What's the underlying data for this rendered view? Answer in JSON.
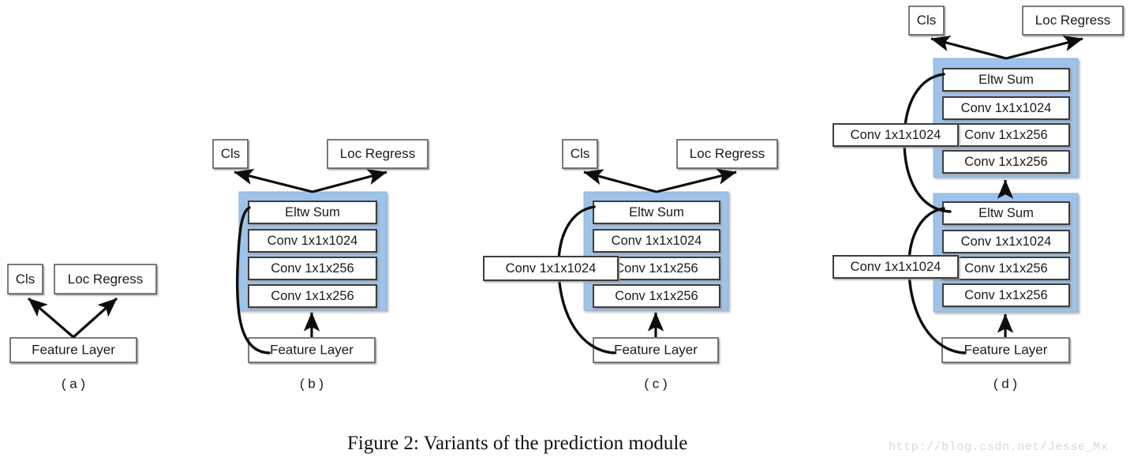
{
  "figure": {
    "caption": "Figure 2: Variants of the prediction module",
    "watermark": "http://blog.csdn.net/Jesse_Mx",
    "colors": {
      "group_fill": "#9ec2e8",
      "group_stroke": "#8db4dd",
      "box_fill": "#ffffff",
      "box_stroke": "#5a5a5a",
      "arrow": "#0d0d0d",
      "text": "#1a1a1a",
      "caption": "#111111",
      "watermark": "#d8d8d8",
      "background": "#ffffff"
    },
    "labels": {
      "cls": "Cls",
      "loc_regress": "Loc Regress",
      "feature_layer": "Feature Layer",
      "eltw_sum": "Eltw Sum",
      "conv_1024": "Conv 1x1x1024",
      "conv_256": "Conv 1x1x256"
    },
    "panels": [
      {
        "id": "a",
        "label": "( a )",
        "nodes": {
          "cls": "Cls",
          "loc_regress": "Loc Regress",
          "feature_layer": "Feature Layer"
        },
        "residual_blocks": 0,
        "has_skip_conv": false
      },
      {
        "id": "b",
        "label": "( b )",
        "nodes": {
          "cls": "Cls",
          "loc_regress": "Loc Regress",
          "feature_layer": "Feature Layer"
        },
        "residual_blocks": 1,
        "has_skip_conv": false,
        "block_layers": [
          "Eltw Sum",
          "Conv 1x1x1024",
          "Conv 1x1x256",
          "Conv 1x1x256"
        ]
      },
      {
        "id": "c",
        "label": "( c )",
        "nodes": {
          "cls": "Cls",
          "loc_regress": "Loc Regress",
          "feature_layer": "Feature Layer"
        },
        "residual_blocks": 1,
        "has_skip_conv": true,
        "skip_conv": "Conv 1x1x1024",
        "block_layers": [
          "Eltw Sum",
          "Conv 1x1x1024",
          "Conv 1x1x256",
          "Conv 1x1x256"
        ]
      },
      {
        "id": "d",
        "label": "( d )",
        "nodes": {
          "cls": "Cls",
          "loc_regress": "Loc Regress",
          "feature_layer": "Feature Layer"
        },
        "residual_blocks": 2,
        "has_skip_conv": true,
        "skip_conv": "Conv 1x1x1024",
        "block_layers": [
          "Eltw Sum",
          "Conv 1x1x1024",
          "Conv 1x1x256",
          "Conv 1x1x256"
        ]
      }
    ]
  },
  "panel_a": {
    "cls": "Cls",
    "loc_regress": "Loc Regress",
    "feature_layer": "Feature Layer",
    "label": "( a )"
  },
  "panel_b": {
    "cls": "Cls",
    "loc_regress": "Loc Regress",
    "feature_layer": "Feature Layer",
    "label": "( b )",
    "block": {
      "l0": "Eltw Sum",
      "l1": "Conv 1x1x1024",
      "l2": "Conv 1x1x256",
      "l3": "Conv 1x1x256"
    }
  },
  "panel_c": {
    "cls": "Cls",
    "loc_regress": "Loc Regress",
    "feature_layer": "Feature Layer",
    "label": "( c )",
    "skip_conv": "Conv 1x1x1024",
    "block": {
      "l0": "Eltw Sum",
      "l1": "Conv 1x1x1024",
      "l2": "Conv 1x1x256",
      "l3": "Conv 1x1x256"
    }
  },
  "panel_d": {
    "cls": "Cls",
    "loc_regress": "Loc Regress",
    "feature_layer": "Feature Layer",
    "label": "( d )",
    "skip_conv_top": "Conv 1x1x1024",
    "skip_conv_bottom": "Conv 1x1x1024",
    "block_top": {
      "l0": "Eltw Sum",
      "l1": "Conv 1x1x1024",
      "l2": "Conv 1x1x256",
      "l3": "Conv 1x1x256"
    },
    "block_bottom": {
      "l0": "Eltw Sum",
      "l1": "Conv 1x1x1024",
      "l2": "Conv 1x1x256",
      "l3": "Conv 1x1x256"
    }
  }
}
